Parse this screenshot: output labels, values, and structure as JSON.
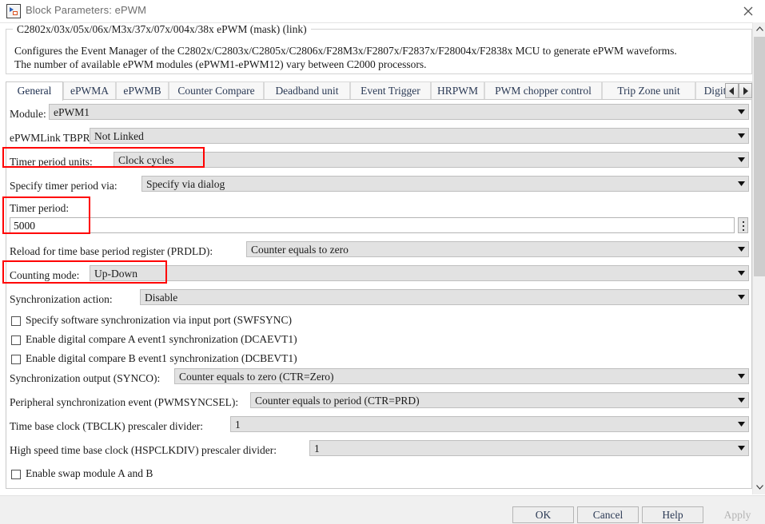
{
  "window": {
    "title": "Block Parameters: ePWM",
    "icon": "block-parameters-icon",
    "close_icon": "close-icon"
  },
  "description": {
    "legend": "C2802x/03x/05x/06x/M3x/37x/07x/004x/38x ePWM (mask) (link)",
    "body": "Configures the Event Manager of the C2802x/C2803x/C2805x/C2806x/F28M3x/F2807x/F2837x/F28004x/F2838x MCU to generate ePWM waveforms.\nThe number of available ePWM modules (ePWM1-ePWM12) vary between C2000 processors."
  },
  "tabs": [
    {
      "label": "General",
      "active": true
    },
    {
      "label": "ePWMA",
      "active": false
    },
    {
      "label": "ePWMB",
      "active": false
    },
    {
      "label": "Counter Compare",
      "active": false
    },
    {
      "label": "Deadband unit",
      "active": false
    },
    {
      "label": "Event Trigger",
      "active": false
    },
    {
      "label": "HRPWM",
      "active": false
    },
    {
      "label": "PWM chopper control",
      "active": false
    },
    {
      "label": "Trip Zone unit",
      "active": false
    },
    {
      "label": "Digital C",
      "active": false
    }
  ],
  "tab_scroll": {
    "left_icon": "chevron-left-icon",
    "right_icon": "chevron-right-icon"
  },
  "form": {
    "module": {
      "label": "Module:",
      "value": "ePWM1"
    },
    "epwmlink_tbprd": {
      "label": "ePWMLink TBPRD",
      "value": "Not Linked"
    },
    "timer_period_units": {
      "label": "Timer period units:",
      "value": "Clock cycles",
      "highlighted": true
    },
    "specify_timer_period_via": {
      "label": "Specify timer period via:",
      "value": "Specify via dialog"
    },
    "timer_period": {
      "label": "Timer period:",
      "value": "5000",
      "highlighted": true,
      "spinner_icon": "vertical-dots-icon"
    },
    "prdld": {
      "label": "Reload for time base period register (PRDLD):",
      "value": "Counter equals to zero"
    },
    "counting_mode": {
      "label": "Counting mode:",
      "value": "Up-Down",
      "highlighted": true
    },
    "sync_action": {
      "label": "Synchronization action:",
      "value": "Disable"
    },
    "swfsync": {
      "label": "Specify software synchronization via input port (SWFSYNC)",
      "checked": false
    },
    "dcaevt1": {
      "label": "Enable digital compare A event1 synchronization (DCAEVT1)",
      "checked": false
    },
    "dcbevt1": {
      "label": "Enable digital compare B event1 synchronization (DCBEVT1)",
      "checked": false
    },
    "synco": {
      "label": "Synchronization output (SYNCO):",
      "value": "Counter equals to zero (CTR=Zero)"
    },
    "pwmsyncsel": {
      "label": "Peripheral synchronization event (PWMSYNCSEL):",
      "value": "Counter equals to period (CTR=PRD)"
    },
    "tbclk": {
      "label": "Time base clock (TBCLK) prescaler divider:",
      "value": "1"
    },
    "hspclkdiv": {
      "label": "High speed time base clock (HSPCLKDIV) prescaler divider:",
      "value": "1"
    },
    "swap_modules": {
      "label": "Enable swap module A and B",
      "checked": false
    }
  },
  "buttons": {
    "ok": "OK",
    "cancel": "Cancel",
    "help": "Help",
    "apply": "Apply",
    "apply_disabled": true
  },
  "colors": {
    "highlight": "#ff0000",
    "combo_bg": "#e2e2e2",
    "tab_text": "#2b3a55"
  }
}
